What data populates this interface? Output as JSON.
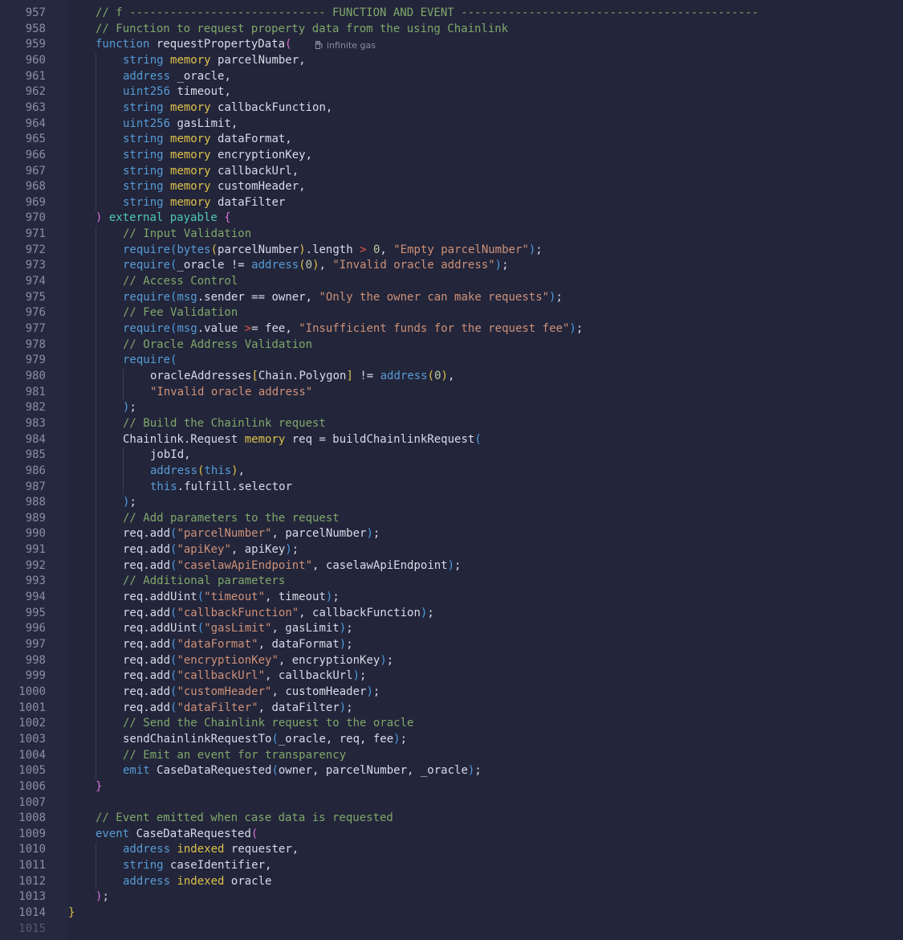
{
  "editor": {
    "code_lens": "infinite gas",
    "lines": [
      {
        "n": "958",
        "indent": 1,
        "tokens": [
          [
            "cm",
            "// Function to request property data from the using Chainlink"
          ]
        ]
      },
      {
        "n": "959",
        "indent": 1,
        "tokens": [
          [
            "kw",
            "function"
          ],
          [
            "",
            " requestPropertyData"
          ],
          [
            "pi",
            "("
          ]
        ]
      },
      {
        "n": "960",
        "indent": 2,
        "tokens": [
          [
            "kw",
            "string"
          ],
          [
            "",
            " "
          ],
          [
            "ye",
            "memory"
          ],
          [
            "",
            " parcelNumber,"
          ]
        ]
      },
      {
        "n": "961",
        "indent": 2,
        "tokens": [
          [
            "kw",
            "address"
          ],
          [
            "",
            " _oracle,"
          ]
        ]
      },
      {
        "n": "962",
        "indent": 2,
        "tokens": [
          [
            "kw",
            "uint256"
          ],
          [
            "",
            " timeout,"
          ]
        ]
      },
      {
        "n": "963",
        "indent": 2,
        "tokens": [
          [
            "kw",
            "string"
          ],
          [
            "",
            " "
          ],
          [
            "ye",
            "memory"
          ],
          [
            "",
            " callbackFunction,"
          ]
        ]
      },
      {
        "n": "964",
        "indent": 2,
        "tokens": [
          [
            "kw",
            "uint256"
          ],
          [
            "",
            " gasLimit,"
          ]
        ]
      },
      {
        "n": "965",
        "indent": 2,
        "tokens": [
          [
            "kw",
            "string"
          ],
          [
            "",
            " "
          ],
          [
            "ye",
            "memory"
          ],
          [
            "",
            " dataFormat,"
          ]
        ]
      },
      {
        "n": "966",
        "indent": 2,
        "tokens": [
          [
            "kw",
            "string"
          ],
          [
            "",
            " "
          ],
          [
            "ye",
            "memory"
          ],
          [
            "",
            " encryptionKey,"
          ]
        ]
      },
      {
        "n": "967",
        "indent": 2,
        "tokens": [
          [
            "kw",
            "string"
          ],
          [
            "",
            " "
          ],
          [
            "ye",
            "memory"
          ],
          [
            "",
            " callbackUrl,"
          ]
        ]
      },
      {
        "n": "968",
        "indent": 2,
        "tokens": [
          [
            "kw",
            "string"
          ],
          [
            "",
            " "
          ],
          [
            "ye",
            "memory"
          ],
          [
            "",
            " customHeader,"
          ]
        ]
      },
      {
        "n": "969",
        "indent": 2,
        "tokens": [
          [
            "kw",
            "string"
          ],
          [
            "",
            " "
          ],
          [
            "ye",
            "memory"
          ],
          [
            "",
            " dataFilter"
          ]
        ]
      },
      {
        "n": "970",
        "indent": 1,
        "tokens": [
          [
            "pi",
            ")"
          ],
          [
            "",
            " "
          ],
          [
            "gr",
            "external"
          ],
          [
            "",
            " "
          ],
          [
            "gr",
            "payable"
          ],
          [
            "",
            " "
          ],
          [
            "pi",
            "{"
          ]
        ]
      },
      {
        "n": "971",
        "indent": 2,
        "tokens": [
          [
            "cm",
            "// Input Validation"
          ]
        ]
      },
      {
        "n": "972",
        "indent": 2,
        "tokens": [
          [
            "kw",
            "require"
          ],
          [
            "bl",
            "("
          ],
          [
            "kw",
            "bytes"
          ],
          [
            "ye",
            "("
          ],
          [
            "",
            "parcelNumber"
          ],
          [
            "ye",
            ")"
          ],
          [
            "",
            ".length "
          ],
          [
            "op",
            ">"
          ],
          [
            "",
            " "
          ],
          [
            "nu",
            "0"
          ],
          [
            "",
            ", "
          ],
          [
            "st",
            "\"Empty parcelNumber\""
          ],
          [
            "bl",
            ")"
          ],
          [
            "",
            ";"
          ]
        ]
      },
      {
        "n": "973",
        "indent": 2,
        "tokens": [
          [
            "kw",
            "require"
          ],
          [
            "bl",
            "("
          ],
          [
            "",
            "_oracle != "
          ],
          [
            "kw",
            "address"
          ],
          [
            "ye",
            "("
          ],
          [
            "nu",
            "0"
          ],
          [
            "ye",
            ")"
          ],
          [
            "",
            ", "
          ],
          [
            "st",
            "\"Invalid oracle address\""
          ],
          [
            "bl",
            ")"
          ],
          [
            "",
            ";"
          ]
        ]
      },
      {
        "n": "974",
        "indent": 2,
        "tokens": [
          [
            "cm",
            "// Access Control"
          ]
        ]
      },
      {
        "n": "975",
        "indent": 2,
        "tokens": [
          [
            "kw",
            "require"
          ],
          [
            "bl",
            "("
          ],
          [
            "kw",
            "msg"
          ],
          [
            "",
            ".sender == owner, "
          ],
          [
            "st",
            "\"Only the owner can make requests\""
          ],
          [
            "bl",
            ")"
          ],
          [
            "",
            ";"
          ]
        ]
      },
      {
        "n": "976",
        "indent": 2,
        "tokens": [
          [
            "cm",
            "// Fee Validation"
          ]
        ]
      },
      {
        "n": "977",
        "indent": 2,
        "tokens": [
          [
            "kw",
            "require"
          ],
          [
            "bl",
            "("
          ],
          [
            "kw",
            "msg"
          ],
          [
            "",
            ".value "
          ],
          [
            "op",
            ">"
          ],
          [
            "",
            "= fee, "
          ],
          [
            "st",
            "\"Insufficient funds for the request fee\""
          ],
          [
            "bl",
            ")"
          ],
          [
            "",
            ";"
          ]
        ]
      },
      {
        "n": "978",
        "indent": 2,
        "tokens": [
          [
            "cm",
            "// Oracle Address Validation"
          ]
        ]
      },
      {
        "n": "979",
        "indent": 2,
        "tokens": [
          [
            "kw",
            "require"
          ],
          [
            "bl",
            "("
          ]
        ]
      },
      {
        "n": "980",
        "indent": 3,
        "tokens": [
          [
            "",
            "oracleAddresses"
          ],
          [
            "ye",
            "["
          ],
          [
            "",
            "Chain.Polygon"
          ],
          [
            "ye",
            "]"
          ],
          [
            "",
            " != "
          ],
          [
            "kw",
            "address"
          ],
          [
            "ye",
            "("
          ],
          [
            "nu",
            "0"
          ],
          [
            "ye",
            ")"
          ],
          [
            "",
            ","
          ]
        ]
      },
      {
        "n": "981",
        "indent": 3,
        "tokens": [
          [
            "st",
            "\"Invalid oracle address\""
          ]
        ]
      },
      {
        "n": "982",
        "indent": 2,
        "tokens": [
          [
            "bl",
            ")"
          ],
          [
            "",
            ";"
          ]
        ]
      },
      {
        "n": "983",
        "indent": 2,
        "tokens": [
          [
            "cm",
            "// Build the Chainlink request"
          ]
        ]
      },
      {
        "n": "984",
        "indent": 2,
        "tokens": [
          [
            "",
            "Chainlink.Request "
          ],
          [
            "ye",
            "memory"
          ],
          [
            "",
            " req = buildChainlinkRequest"
          ],
          [
            "bl",
            "("
          ]
        ]
      },
      {
        "n": "985",
        "indent": 3,
        "tokens": [
          [
            "",
            "jobId,"
          ]
        ]
      },
      {
        "n": "986",
        "indent": 3,
        "tokens": [
          [
            "kw",
            "address"
          ],
          [
            "ye",
            "("
          ],
          [
            "kw",
            "this"
          ],
          [
            "ye",
            ")"
          ],
          [
            "",
            ","
          ]
        ]
      },
      {
        "n": "987",
        "indent": 3,
        "tokens": [
          [
            "kw",
            "this"
          ],
          [
            "",
            ".fulfill.selector"
          ]
        ]
      },
      {
        "n": "988",
        "indent": 2,
        "tokens": [
          [
            "bl",
            ")"
          ],
          [
            "",
            ";"
          ]
        ]
      },
      {
        "n": "989",
        "indent": 2,
        "tokens": [
          [
            "cm",
            "// Add parameters to the request"
          ]
        ]
      },
      {
        "n": "990",
        "indent": 2,
        "tokens": [
          [
            "",
            "req.add"
          ],
          [
            "bl",
            "("
          ],
          [
            "st",
            "\"parcelNumber\""
          ],
          [
            "",
            ", parcelNumber"
          ],
          [
            "bl",
            ")"
          ],
          [
            "",
            ";"
          ]
        ]
      },
      {
        "n": "991",
        "indent": 2,
        "tokens": [
          [
            "",
            "req.add"
          ],
          [
            "bl",
            "("
          ],
          [
            "st",
            "\"apiKey\""
          ],
          [
            "",
            ", apiKey"
          ],
          [
            "bl",
            ")"
          ],
          [
            "",
            ";"
          ]
        ]
      },
      {
        "n": "992",
        "indent": 2,
        "tokens": [
          [
            "",
            "req.add"
          ],
          [
            "bl",
            "("
          ],
          [
            "st",
            "\"caselawApiEndpoint\""
          ],
          [
            "",
            ", caselawApiEndpoint"
          ],
          [
            "bl",
            ")"
          ],
          [
            "",
            ";"
          ]
        ]
      },
      {
        "n": "993",
        "indent": 2,
        "tokens": [
          [
            "cm",
            "// Additional parameters"
          ]
        ]
      },
      {
        "n": "994",
        "indent": 2,
        "tokens": [
          [
            "",
            "req.addUint"
          ],
          [
            "bl",
            "("
          ],
          [
            "st",
            "\"timeout\""
          ],
          [
            "",
            ", timeout"
          ],
          [
            "bl",
            ")"
          ],
          [
            "",
            ";"
          ]
        ]
      },
      {
        "n": "995",
        "indent": 2,
        "tokens": [
          [
            "",
            "req.add"
          ],
          [
            "bl",
            "("
          ],
          [
            "st",
            "\"callbackFunction\""
          ],
          [
            "",
            ", callbackFunction"
          ],
          [
            "bl",
            ")"
          ],
          [
            "",
            ";"
          ]
        ]
      },
      {
        "n": "996",
        "indent": 2,
        "tokens": [
          [
            "",
            "req.addUint"
          ],
          [
            "bl",
            "("
          ],
          [
            "st",
            "\"gasLimit\""
          ],
          [
            "",
            ", gasLimit"
          ],
          [
            "bl",
            ")"
          ],
          [
            "",
            ";"
          ]
        ]
      },
      {
        "n": "997",
        "indent": 2,
        "tokens": [
          [
            "",
            "req.add"
          ],
          [
            "bl",
            "("
          ],
          [
            "st",
            "\"dataFormat\""
          ],
          [
            "",
            ", dataFormat"
          ],
          [
            "bl",
            ")"
          ],
          [
            "",
            ";"
          ]
        ]
      },
      {
        "n": "998",
        "indent": 2,
        "tokens": [
          [
            "",
            "req.add"
          ],
          [
            "bl",
            "("
          ],
          [
            "st",
            "\"encryptionKey\""
          ],
          [
            "",
            ", encryptionKey"
          ],
          [
            "bl",
            ")"
          ],
          [
            "",
            ";"
          ]
        ]
      },
      {
        "n": "999",
        "indent": 2,
        "tokens": [
          [
            "",
            "req.add"
          ],
          [
            "bl",
            "("
          ],
          [
            "st",
            "\"callbackUrl\""
          ],
          [
            "",
            ", callbackUrl"
          ],
          [
            "bl",
            ")"
          ],
          [
            "",
            ";"
          ]
        ]
      },
      {
        "n": "1000",
        "indent": 2,
        "tokens": [
          [
            "",
            "req.add"
          ],
          [
            "bl",
            "("
          ],
          [
            "st",
            "\"customHeader\""
          ],
          [
            "",
            ", customHeader"
          ],
          [
            "bl",
            ")"
          ],
          [
            "",
            ";"
          ]
        ]
      },
      {
        "n": "1001",
        "indent": 2,
        "tokens": [
          [
            "",
            "req.add"
          ],
          [
            "bl",
            "("
          ],
          [
            "st",
            "\"dataFilter\""
          ],
          [
            "",
            ", dataFilter"
          ],
          [
            "bl",
            ")"
          ],
          [
            "",
            ";"
          ]
        ]
      },
      {
        "n": "1002",
        "indent": 2,
        "tokens": [
          [
            "cm",
            "// Send the Chainlink request to the oracle"
          ]
        ]
      },
      {
        "n": "1003",
        "indent": 2,
        "tokens": [
          [
            "",
            "sendChainlinkRequestTo"
          ],
          [
            "bl",
            "("
          ],
          [
            "",
            "_oracle, req, fee"
          ],
          [
            "bl",
            ")"
          ],
          [
            "",
            ";"
          ]
        ]
      },
      {
        "n": "1004",
        "indent": 2,
        "tokens": [
          [
            "cm",
            "// Emit an event for transparency"
          ]
        ]
      },
      {
        "n": "1005",
        "indent": 2,
        "tokens": [
          [
            "kw",
            "emit"
          ],
          [
            "",
            " CaseDataRequested"
          ],
          [
            "bl",
            "("
          ],
          [
            "",
            "owner, parcelNumber, _oracle"
          ],
          [
            "bl",
            ")"
          ],
          [
            "",
            ";"
          ]
        ]
      },
      {
        "n": "1006",
        "indent": 1,
        "tokens": [
          [
            "pi",
            "}"
          ]
        ]
      },
      {
        "n": "1007",
        "indent": 0,
        "tokens": []
      },
      {
        "n": "1008",
        "indent": 1,
        "tokens": [
          [
            "cm",
            "// Event emitted when case data is requested"
          ]
        ]
      },
      {
        "n": "1009",
        "indent": 1,
        "tokens": [
          [
            "kw",
            "event"
          ],
          [
            "",
            " CaseDataRequested"
          ],
          [
            "pi",
            "("
          ]
        ]
      },
      {
        "n": "1010",
        "indent": 2,
        "tokens": [
          [
            "kw",
            "address"
          ],
          [
            "",
            " "
          ],
          [
            "ye",
            "indexed"
          ],
          [
            "",
            " requester,"
          ]
        ]
      },
      {
        "n": "1011",
        "indent": 2,
        "tokens": [
          [
            "kw",
            "string"
          ],
          [
            "",
            " caseIdentifier,"
          ]
        ]
      },
      {
        "n": "1012",
        "indent": 2,
        "tokens": [
          [
            "kw",
            "address"
          ],
          [
            "",
            " "
          ],
          [
            "ye",
            "indexed"
          ],
          [
            "",
            " oracle"
          ]
        ]
      },
      {
        "n": "1013",
        "indent": 1,
        "tokens": [
          [
            "pi",
            ")"
          ],
          [
            "",
            ";"
          ]
        ]
      },
      {
        "n": "1014",
        "indent": 0,
        "tokens": [
          [
            "ye",
            "}"
          ]
        ]
      },
      {
        "n": "1015",
        "indent": 0,
        "tokens": []
      }
    ],
    "first_line": {
      "n": "957",
      "tokens": [
        [
          "cm",
          "// f ----------------------------- FUNCTION AND EVENT --------------------------------------------"
        ]
      ]
    }
  }
}
